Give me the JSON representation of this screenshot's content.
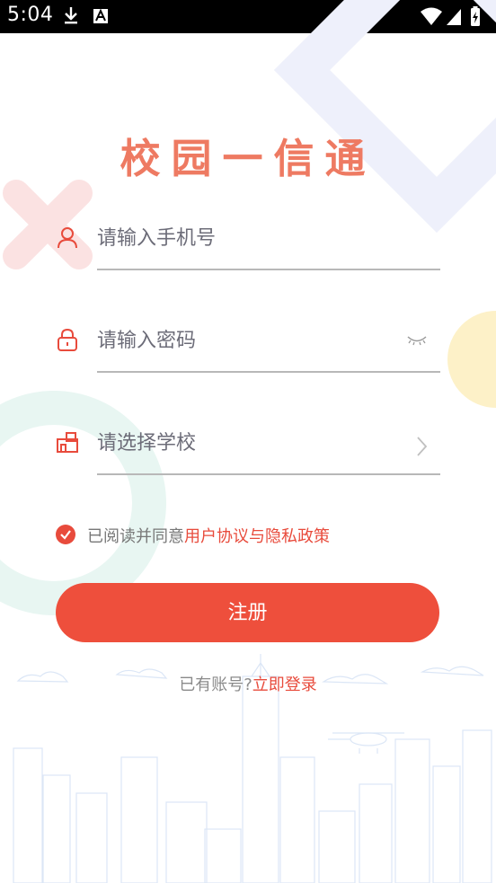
{
  "status": {
    "time": "5:04"
  },
  "title": "校园一信通",
  "form": {
    "phone_placeholder": "请输入手机号",
    "password_placeholder": "请输入密码",
    "school_placeholder": "请选择学校"
  },
  "agreement": {
    "prefix": "已阅读并同意",
    "link": "用户协议与隐私政策",
    "checked": true
  },
  "register_label": "注册",
  "login": {
    "prefix": "已有账号?",
    "link": "立即登录"
  },
  "colors": {
    "accent": "#ee4f3c",
    "title": "#ee7a62",
    "status_bar": "#000000"
  },
  "icons": [
    "download-icon",
    "font-notification-icon",
    "wifi-icon",
    "signal-icon",
    "battery-icon",
    "user-icon",
    "lock-icon",
    "eye-closed-icon",
    "school-icon",
    "chevron-right-icon",
    "check-icon"
  ]
}
